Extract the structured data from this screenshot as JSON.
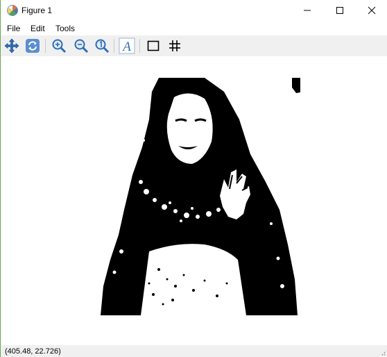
{
  "window": {
    "title": "Figure 1",
    "icons": {
      "app": "matplotlib-icon",
      "minimize": "minimize-icon",
      "maximize": "maximize-icon",
      "close": "close-icon"
    }
  },
  "menu": {
    "items": [
      "File",
      "Edit",
      "Tools"
    ]
  },
  "toolbar": {
    "tools": [
      {
        "name": "pan",
        "icon": "pan-arrows-icon"
      },
      {
        "name": "reset",
        "icon": "refresh-icon"
      },
      {
        "name": "zoom-in",
        "icon": "zoom-in-icon"
      },
      {
        "name": "zoom-out",
        "icon": "zoom-out-icon"
      },
      {
        "name": "zoom-1to1",
        "icon": "zoom-1to1-icon"
      },
      {
        "name": "edit-axis",
        "icon": "italic-a-icon"
      },
      {
        "name": "subplot",
        "icon": "square-icon"
      },
      {
        "name": "grid",
        "icon": "grid-icon"
      }
    ],
    "accent": "#2f6db5"
  },
  "figure": {
    "image": "binarized black-and-white photo of a woman in a hijab waving",
    "colors": {
      "foreground": "#000000",
      "background": "#ffffff"
    }
  },
  "status": {
    "coords": "(405.48, 22.726)"
  }
}
